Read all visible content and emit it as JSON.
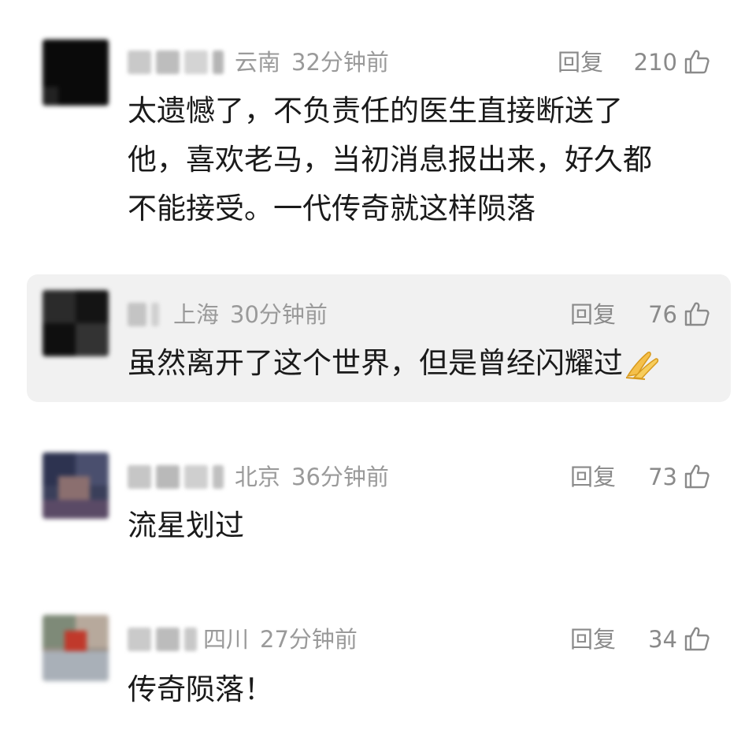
{
  "comments": [
    {
      "location": "云南",
      "time": "32分钟前",
      "reply_label": "回复",
      "likes": "210",
      "text_lines": [
        "太遗憾了，不负责任的医生直接断送了",
        "他，喜欢老马，当初消息报出来，好久都",
        "不能接受。一代传奇就这样陨落"
      ],
      "highlighted": false
    },
    {
      "location": "上海",
      "time": "30分钟前",
      "reply_label": "回复",
      "likes": "76",
      "text_lines": [
        "虽然离开了这个世界，但是曾经闪耀过"
      ],
      "highlighted": true,
      "trailing_emoji": "folded-hands-emoji"
    },
    {
      "location": "北京",
      "time": "36分钟前",
      "reply_label": "回复",
      "likes": "73",
      "text_lines": [
        "流星划过"
      ],
      "highlighted": false
    },
    {
      "location": "四川",
      "time": "27分钟前",
      "reply_label": "回复",
      "likes": "34",
      "text_lines": [
        "传奇陨落！"
      ],
      "highlighted": false
    }
  ],
  "colors": {
    "text": "#1a1a1a",
    "meta": "#9a9a9a",
    "highlight_bg": "#f1f1f1"
  }
}
